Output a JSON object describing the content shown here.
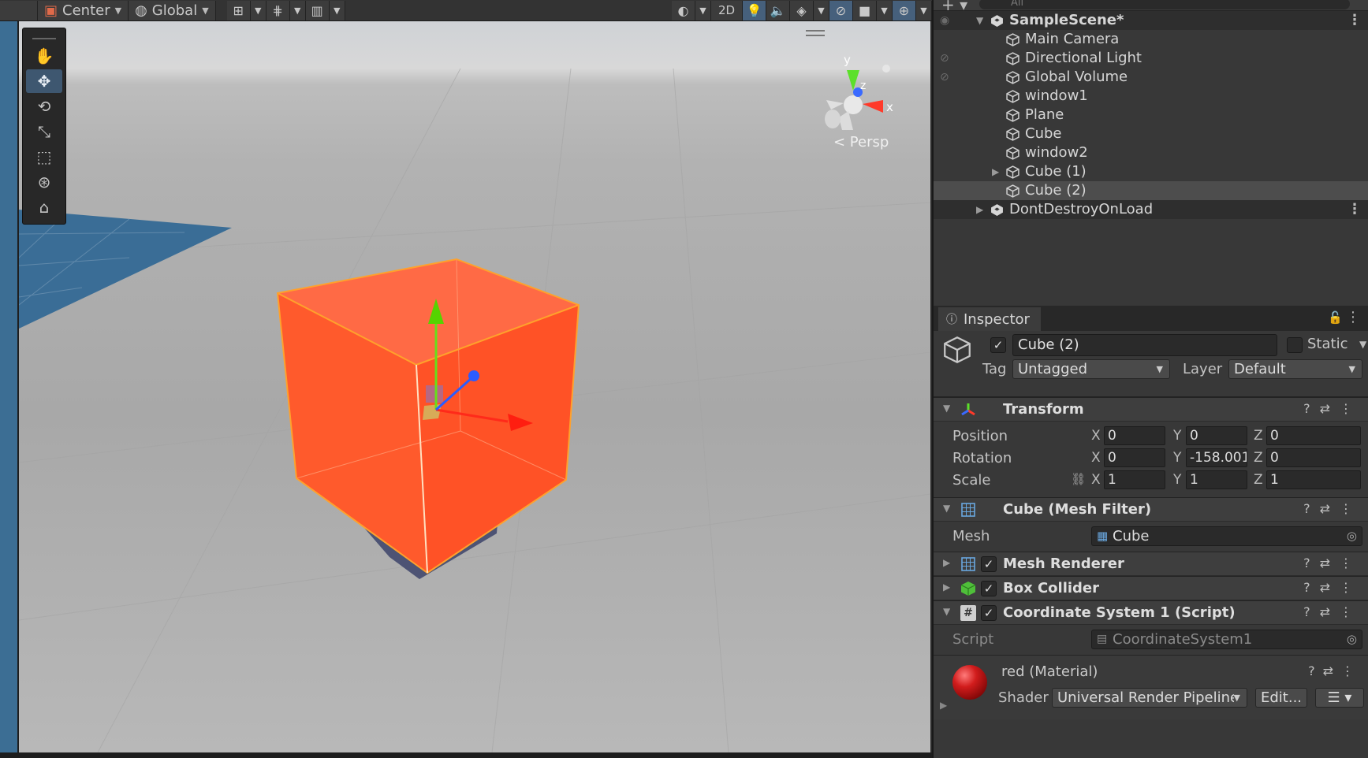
{
  "toolbar": {
    "pivot_label": "Center",
    "space_label": "Global",
    "mode_2d_label": "2D"
  },
  "scene_view": {
    "projection_label": "< Persp",
    "axis_labels": {
      "x": "x",
      "y": "y",
      "z": "z"
    }
  },
  "hierarchy": {
    "search_placeholder": "All",
    "scene_name": "SampleScene*",
    "items": [
      {
        "label": "Main Camera"
      },
      {
        "label": "Directional Light"
      },
      {
        "label": "Global Volume"
      },
      {
        "label": "window1"
      },
      {
        "label": "Plane"
      },
      {
        "label": "Cube"
      },
      {
        "label": "window2"
      },
      {
        "label": "Cube (1)"
      },
      {
        "label": "Cube (2)"
      }
    ],
    "dont_destroy_label": "DontDestroyOnLoad"
  },
  "inspector": {
    "tab_label": "Inspector",
    "object_name": "Cube (2)",
    "static_label": "Static",
    "tag_label": "Tag",
    "tag_value": "Untagged",
    "layer_label": "Layer",
    "layer_value": "Default",
    "transform": {
      "title": "Transform",
      "position_label": "Position",
      "rotation_label": "Rotation",
      "scale_label": "Scale",
      "axis_x": "X",
      "axis_y": "Y",
      "axis_z": "Z",
      "position": {
        "x": "0",
        "y": "0",
        "z": "0"
      },
      "rotation": {
        "x": "0",
        "y": "-158.001",
        "z": "0"
      },
      "scale": {
        "x": "1",
        "y": "1",
        "z": "1"
      }
    },
    "mesh_filter": {
      "title": "Cube (Mesh Filter)",
      "mesh_label": "Mesh",
      "mesh_value": "Cube"
    },
    "mesh_renderer": {
      "title": "Mesh Renderer"
    },
    "box_collider": {
      "title": "Box Collider"
    },
    "script_component": {
      "title": "Coordinate System 1 (Script)",
      "script_label": "Script",
      "script_value": "CoordinateSystem1"
    },
    "material": {
      "name": "red (Material)",
      "shader_label": "Shader",
      "shader_value": "Universal Render Pipeline",
      "edit_label": "Edit..."
    }
  },
  "colors": {
    "cube_orange": "#ff5a2c",
    "selection_outline": "#ff8a1e",
    "inspector_bg": "#383838",
    "hierarchy_selected": "#4d4d4d"
  }
}
